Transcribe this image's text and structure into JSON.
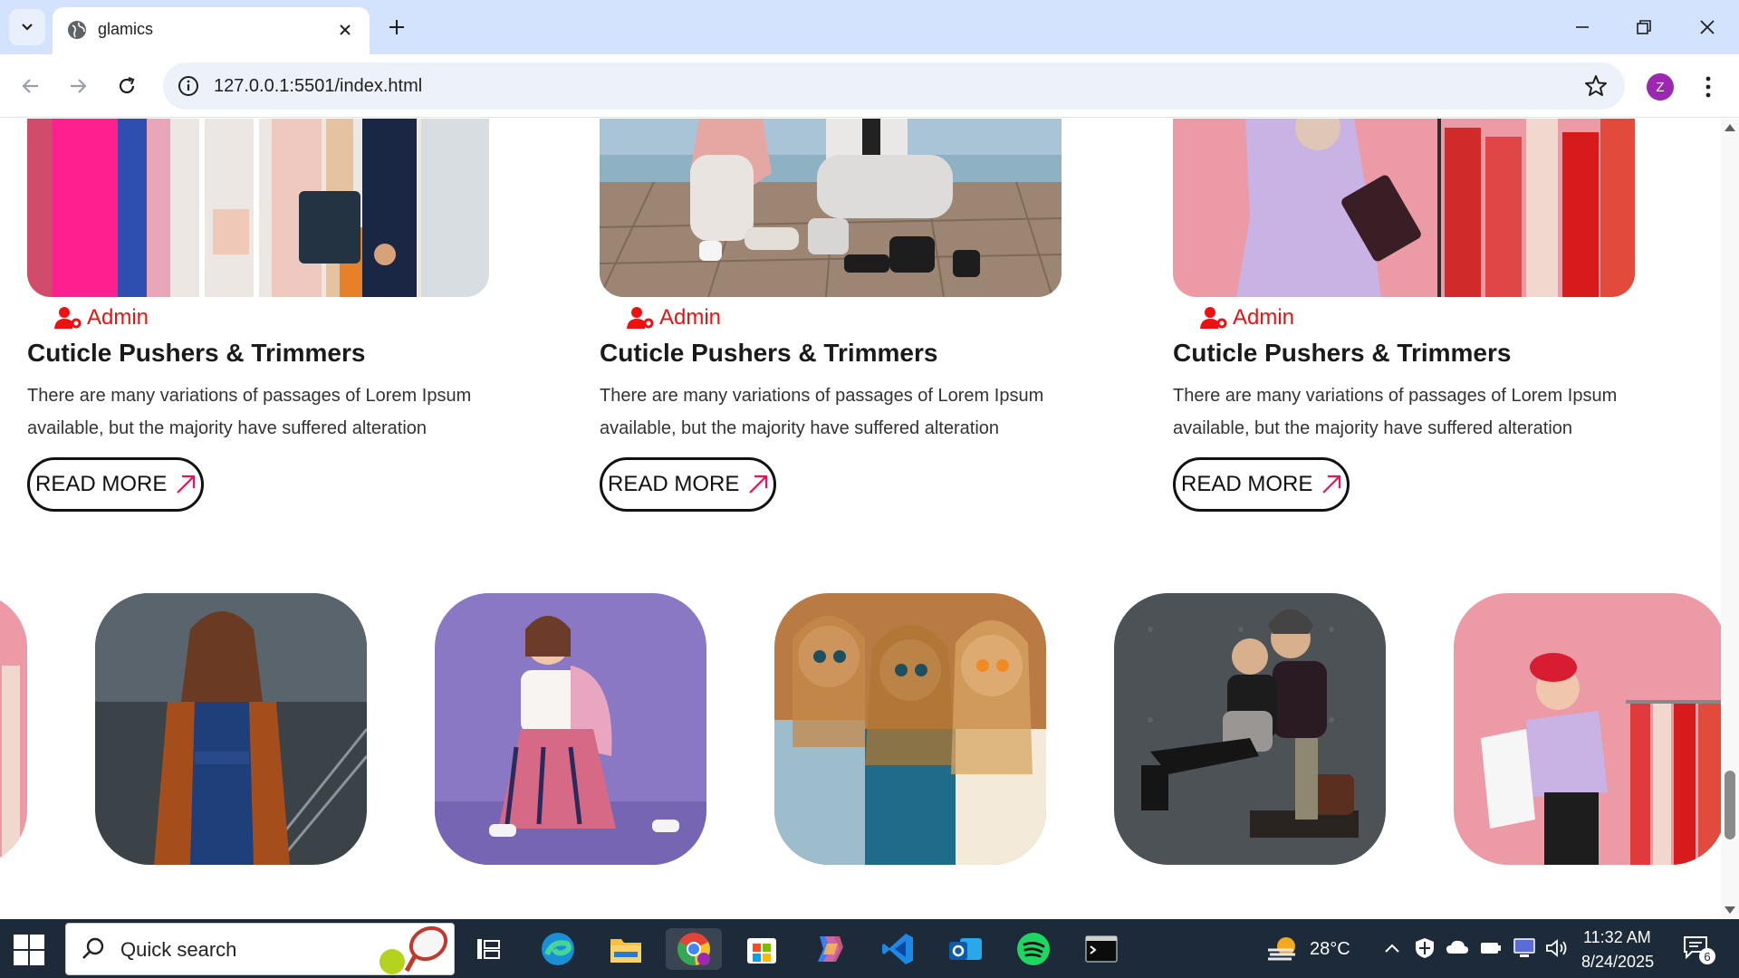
{
  "browser": {
    "tab_title": "glamics",
    "url": "127.0.0.1:5501/index.html",
    "profile_initial": "Z"
  },
  "blog": {
    "cards": [
      {
        "author": "Admin",
        "title": "Cuticle Pushers & Trimmers",
        "text": "There are many variations of passages of Lorem Ipsum available, but the majority have suffered alteration",
        "button": "READ MORE"
      },
      {
        "author": "Admin",
        "title": "Cuticle Pushers & Trimmers",
        "text": "There are many variations of passages of Lorem Ipsum available, but the majority have suffered alteration",
        "button": "READ MORE"
      },
      {
        "author": "Admin",
        "title": "Cuticle Pushers & Trimmers",
        "text": "There are many variations of passages of Lorem Ipsum available, but the majority have suffered alteration",
        "button": "READ MORE"
      }
    ]
  },
  "taskbar": {
    "search_placeholder": "Quick search",
    "weather": "28°C",
    "time": "11:32 AM",
    "date": "8/24/2025",
    "notifications": "6"
  },
  "colors": {
    "accent": "#ee1111",
    "tabbar": "#d3e3fd",
    "taskbar": "#1c2a3a"
  }
}
